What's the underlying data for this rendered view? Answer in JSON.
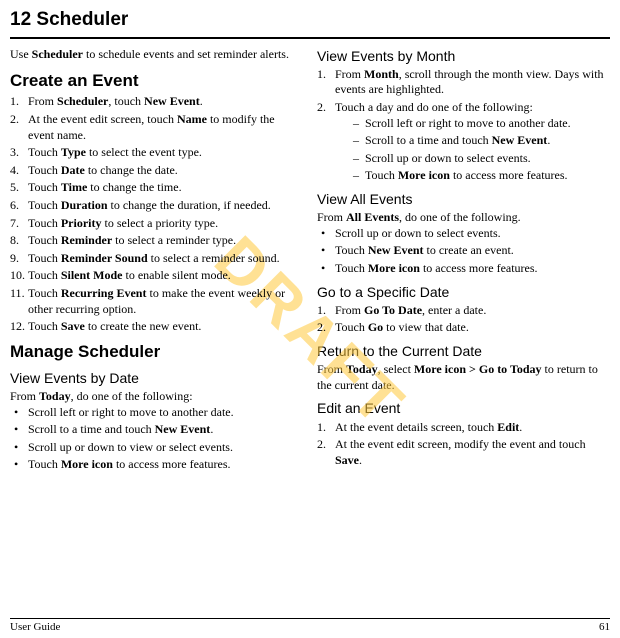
{
  "chapter": {
    "title": "12   Scheduler"
  },
  "intro": {
    "pre": "Use ",
    "bold": "Scheduler",
    "post": " to schedule events and set reminder alerts."
  },
  "sec1": {
    "heading": "Create an Event",
    "items": [
      {
        "pre": "From ",
        "b1": "Scheduler",
        "mid": ", touch ",
        "b2": "New Event",
        "post": "."
      },
      {
        "pre": "At the event edit screen, touch ",
        "b1": "Name",
        "post": " to modify the event name."
      },
      {
        "pre": "Touch ",
        "b1": "Type",
        "post": " to select the event type."
      },
      {
        "pre": "Touch ",
        "b1": "Date",
        "post": " to change the date."
      },
      {
        "pre": "Touch ",
        "b1": "Time",
        "post": " to change the time."
      },
      {
        "pre": "Touch ",
        "b1": "Duration",
        "post": " to change the duration, if needed."
      },
      {
        "pre": "Touch ",
        "b1": "Priority",
        "post": " to select a priority type."
      },
      {
        "pre": "Touch ",
        "b1": "Reminder",
        "post": " to select a reminder type."
      },
      {
        "pre": "Touch ",
        "b1": "Reminder Sound",
        "post": " to select a reminder sound."
      },
      {
        "pre": "Touch ",
        "b1": "Silent Mode",
        "post": " to enable silent mode."
      },
      {
        "pre": "Touch ",
        "b1": "Recurring Event",
        "post": " to make the event weekly or other recurring option."
      },
      {
        "pre": "Touch ",
        "b1": "Save",
        "post": " to create the new event."
      }
    ]
  },
  "sec2": {
    "heading": "Manage Scheduler"
  },
  "sec3": {
    "heading": "View Events by Date",
    "intro": {
      "pre": "From ",
      "b": "Today",
      "post": ", do one of the following:"
    },
    "items": [
      {
        "text": "Scroll left or right to move to another date."
      },
      {
        "pre": "Scroll to a time and touch ",
        "b": "New Event",
        "post": "."
      },
      {
        "text": "Scroll up or down to view or select events."
      },
      {
        "pre": "Touch ",
        "b": "More icon",
        "post": " to access more features."
      }
    ]
  },
  "sec4": {
    "heading": "View Events by Month",
    "items": [
      {
        "pre": "From ",
        "b": "Month",
        "post": ", scroll through the month view. Days with events are highlighted."
      },
      {
        "text": "Touch a day and do one of the following:",
        "sub": [
          {
            "text": "Scroll left or right to move to another date."
          },
          {
            "pre": "Scroll to a time and touch ",
            "b": "New Event",
            "post": "."
          },
          {
            "text": "Scroll up or down to select events."
          },
          {
            "pre": "Touch ",
            "b": "More icon",
            "post": " to access more features."
          }
        ]
      }
    ]
  },
  "sec5": {
    "heading": "View All Events",
    "intro": {
      "pre": "From ",
      "b": "All Events",
      "post": ", do one of the following."
    },
    "items": [
      {
        "text": "Scroll up or down to select events."
      },
      {
        "pre": "Touch ",
        "b": "New Event",
        "post": " to create an event."
      },
      {
        "pre": "Touch ",
        "b": "More icon",
        "post": " to access more features."
      }
    ]
  },
  "sec6": {
    "heading": "Go to a Specific Date",
    "items": [
      {
        "pre": "From ",
        "b": "Go To Date",
        "post": ", enter a date."
      },
      {
        "pre": "Touch ",
        "b": "Go",
        "post": " to view that date."
      }
    ]
  },
  "sec7": {
    "heading": "Return to the Current Date",
    "body": {
      "pre": "From ",
      "b1": "Today",
      "mid": ", select ",
      "b2": "More icon > Go to Today",
      "post": " to return to the current date."
    }
  },
  "sec8": {
    "heading": "Edit an Event",
    "items": [
      {
        "pre": "At the event details screen, touch ",
        "b": "Edit",
        "post": "."
      },
      {
        "pre": "At the event edit screen, modify the event and touch ",
        "b": "Save",
        "post": "."
      }
    ]
  },
  "footer": {
    "left": "User Guide",
    "right": "61"
  },
  "watermark": "DRAFT"
}
